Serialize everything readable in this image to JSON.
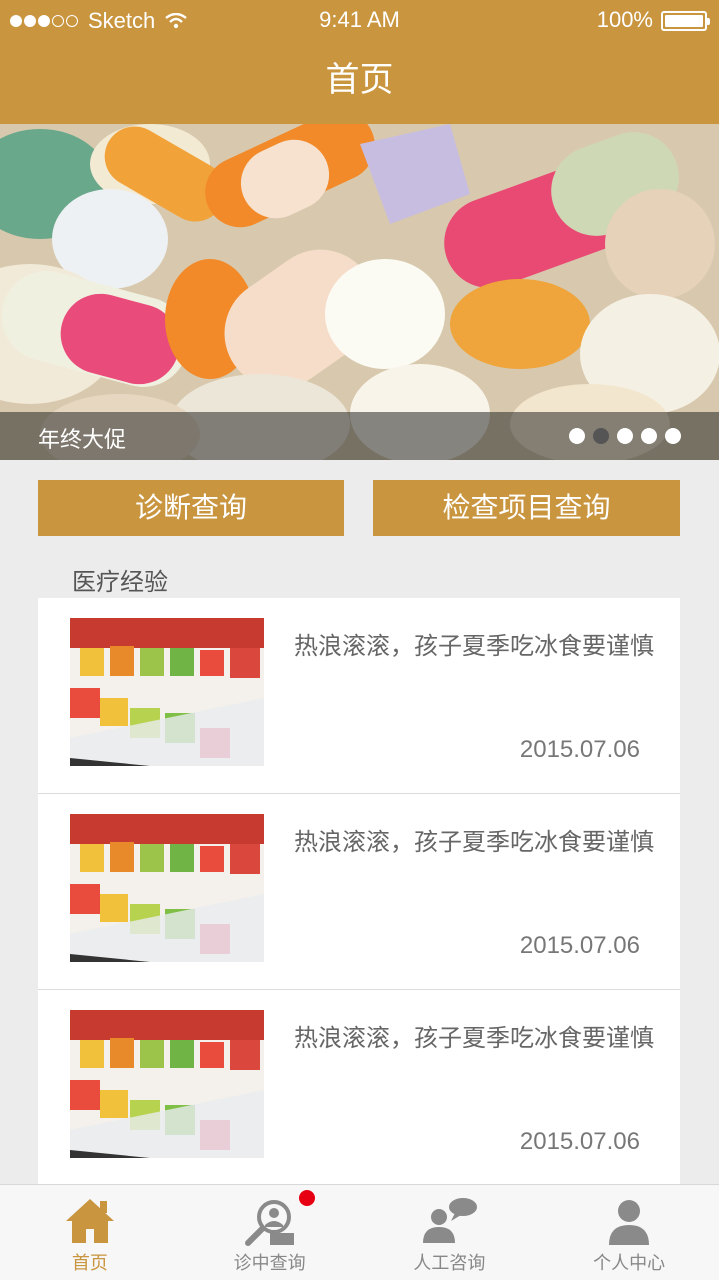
{
  "status_bar": {
    "carrier": "Sketch",
    "time": "9:41 AM",
    "battery": "100%"
  },
  "nav": {
    "title": "首页"
  },
  "banner": {
    "caption": "年终大促",
    "page_count": 5,
    "active_page": 2
  },
  "buttons": {
    "diagnose": "诊断查询",
    "exam": "检查项目查询"
  },
  "section": {
    "title": "医疗经验"
  },
  "articles": [
    {
      "headline": "热浪滚滚，孩子夏季吃冰食要谨慎",
      "date": "2015.07.06"
    },
    {
      "headline": "热浪滚滚，孩子夏季吃冰食要谨慎",
      "date": "2015.07.06"
    },
    {
      "headline": "热浪滚滚，孩子夏季吃冰食要谨慎",
      "date": "2015.07.06"
    }
  ],
  "tabs": [
    {
      "label": "首页",
      "icon": "home-icon",
      "active": true
    },
    {
      "label": "诊中查询",
      "icon": "search-person-icon",
      "badge": true
    },
    {
      "label": "人工咨询",
      "icon": "chat-consult-icon"
    },
    {
      "label": "个人中心",
      "icon": "person-icon"
    }
  ],
  "colors": {
    "brand": "#c9953f",
    "badge": "#e60012",
    "tab_inactive": "#888888"
  }
}
